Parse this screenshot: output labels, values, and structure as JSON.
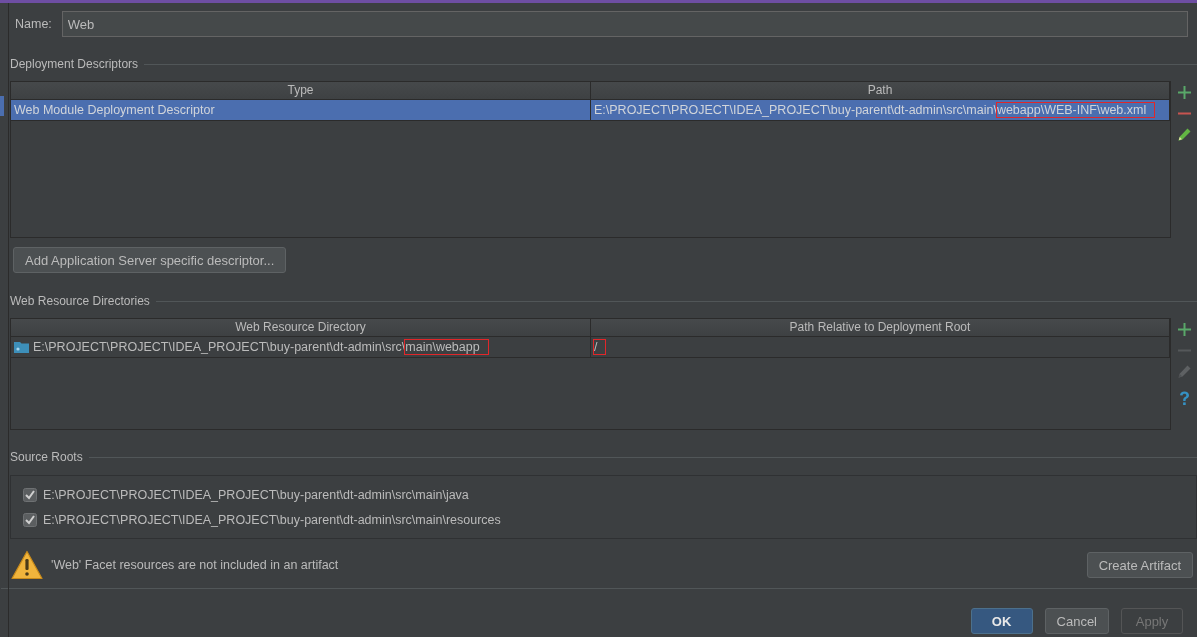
{
  "name_field": {
    "label": "Name:",
    "value": "Web"
  },
  "deployment_descriptors": {
    "title": "Deployment Descriptors",
    "columns": [
      "Type",
      "Path"
    ],
    "rows": [
      {
        "selected": true,
        "cells": [
          [
            {
              "text": "Web Module Deployment Descriptor",
              "annotated": false
            }
          ],
          [
            {
              "text": "E:\\PROJECT\\PROJECT\\IDEA_PROJECT\\buy-parent\\dt-admin\\src\\main\\",
              "annotated": false
            },
            {
              "text": "webapp\\WEB-INF\\web.xml",
              "annotated": true
            }
          ]
        ]
      }
    ],
    "toolbar": [
      {
        "kind": "add",
        "disabled": false
      },
      {
        "kind": "remove",
        "disabled": false
      },
      {
        "kind": "edit",
        "disabled": false
      }
    ]
  },
  "add_descriptor_button": "Add Application Server specific descriptor...",
  "web_resource_directories": {
    "title": "Web Resource Directories",
    "columns": [
      "Web Resource Directory",
      "Path Relative to Deployment Root"
    ],
    "rows": [
      {
        "selected": false,
        "cells": [
          [
            {
              "text": "E:\\PROJECT\\PROJECT\\IDEA_PROJECT\\buy-parent\\dt-admin\\src\\",
              "annotated": false
            },
            {
              "text": "main\\webapp",
              "annotated": true
            }
          ],
          [
            {
              "text": "/",
              "annotated": true
            }
          ]
        ]
      }
    ],
    "toolbar": [
      {
        "kind": "add",
        "disabled": false
      },
      {
        "kind": "remove",
        "disabled": true
      },
      {
        "kind": "edit",
        "disabled": true
      },
      {
        "kind": "help",
        "disabled": false
      }
    ]
  },
  "source_roots": {
    "title": "Source Roots",
    "items": [
      {
        "path": "E:\\PROJECT\\PROJECT\\IDEA_PROJECT\\buy-parent\\dt-admin\\src\\main\\java",
        "checked": true
      },
      {
        "path": "E:\\PROJECT\\PROJECT\\IDEA_PROJECT\\buy-parent\\dt-admin\\src\\main\\resources",
        "checked": true
      }
    ]
  },
  "warning": {
    "text": "'Web' Facet resources are not included in an artifact",
    "button": "Create Artifact"
  },
  "buttons": [
    {
      "label": "OK",
      "kind": "default",
      "disabled": false
    },
    {
      "label": "Cancel",
      "kind": "normal",
      "disabled": false
    },
    {
      "label": "Apply",
      "kind": "normal",
      "disabled": true
    }
  ]
}
